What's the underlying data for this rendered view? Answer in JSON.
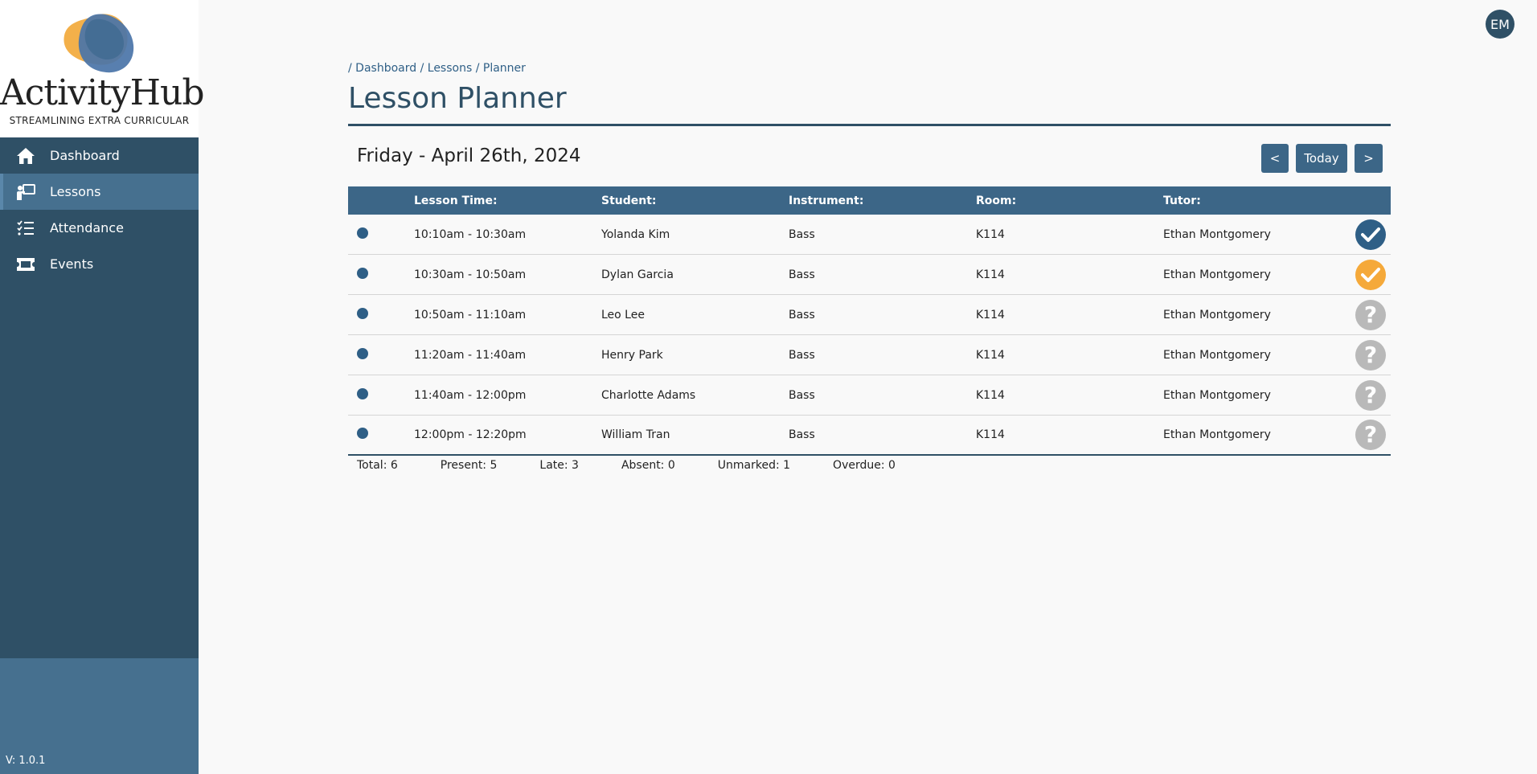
{
  "app": {
    "logo_title": "ActivityHub",
    "logo_tagline": "STREAMLINING EXTRA CURRICULAR",
    "version": "V: 1.0.1",
    "user_initials": "EM",
    "colors": {
      "primary": "#2f5066",
      "accent": "#3c6687",
      "present": "#2f5f86",
      "late": "#f5a93a",
      "unmarked": "#b9b9b9"
    }
  },
  "sidebar": {
    "items": [
      {
        "label": "Dashboard",
        "icon": "home-icon"
      },
      {
        "label": "Lessons",
        "icon": "lessons-icon"
      },
      {
        "label": "Attendance",
        "icon": "checklist-icon"
      },
      {
        "label": "Events",
        "icon": "ticket-icon"
      }
    ]
  },
  "breadcrumb": {
    "sep1": "/",
    "item1": "Dashboard",
    "sep2": "/",
    "item2": "Lessons",
    "sep3": "/",
    "item3": "Planner"
  },
  "page": {
    "title": "Lesson Planner",
    "date": "Friday - April 26th, 2024"
  },
  "nav_buttons": {
    "prev": "<",
    "today": "Today",
    "next": ">"
  },
  "table": {
    "headers": {
      "time": "Lesson Time:",
      "student": "Student:",
      "instrument": "Instrument:",
      "room": "Room:",
      "tutor": "Tutor:"
    },
    "rows": [
      {
        "time": "10:10am - 10:30am",
        "student": "Yolanda Kim",
        "instrument": "Bass",
        "room": "K114",
        "tutor": "Ethan Montgomery",
        "status": "present"
      },
      {
        "time": "10:30am - 10:50am",
        "student": "Dylan Garcia",
        "instrument": "Bass",
        "room": "K114",
        "tutor": "Ethan Montgomery",
        "status": "late"
      },
      {
        "time": "10:50am - 11:10am",
        "student": "Leo Lee",
        "instrument": "Bass",
        "room": "K114",
        "tutor": "Ethan Montgomery",
        "status": "unmarked"
      },
      {
        "time": "11:20am - 11:40am",
        "student": "Henry Park",
        "instrument": "Bass",
        "room": "K114",
        "tutor": "Ethan Montgomery",
        "status": "unmarked"
      },
      {
        "time": "11:40am - 12:00pm",
        "student": "Charlotte Adams",
        "instrument": "Bass",
        "room": "K114",
        "tutor": "Ethan Montgomery",
        "status": "unmarked"
      },
      {
        "time": "12:00pm - 12:20pm",
        "student": "William Tran",
        "instrument": "Bass",
        "room": "K114",
        "tutor": "Ethan Montgomery",
        "status": "unmarked"
      }
    ]
  },
  "summary": {
    "total": "Total: 6",
    "present": "Present: 5",
    "late": "Late: 3",
    "absent": "Absent: 0",
    "unmarked": "Unmarked: 1",
    "overdue": "Overdue: 0"
  }
}
